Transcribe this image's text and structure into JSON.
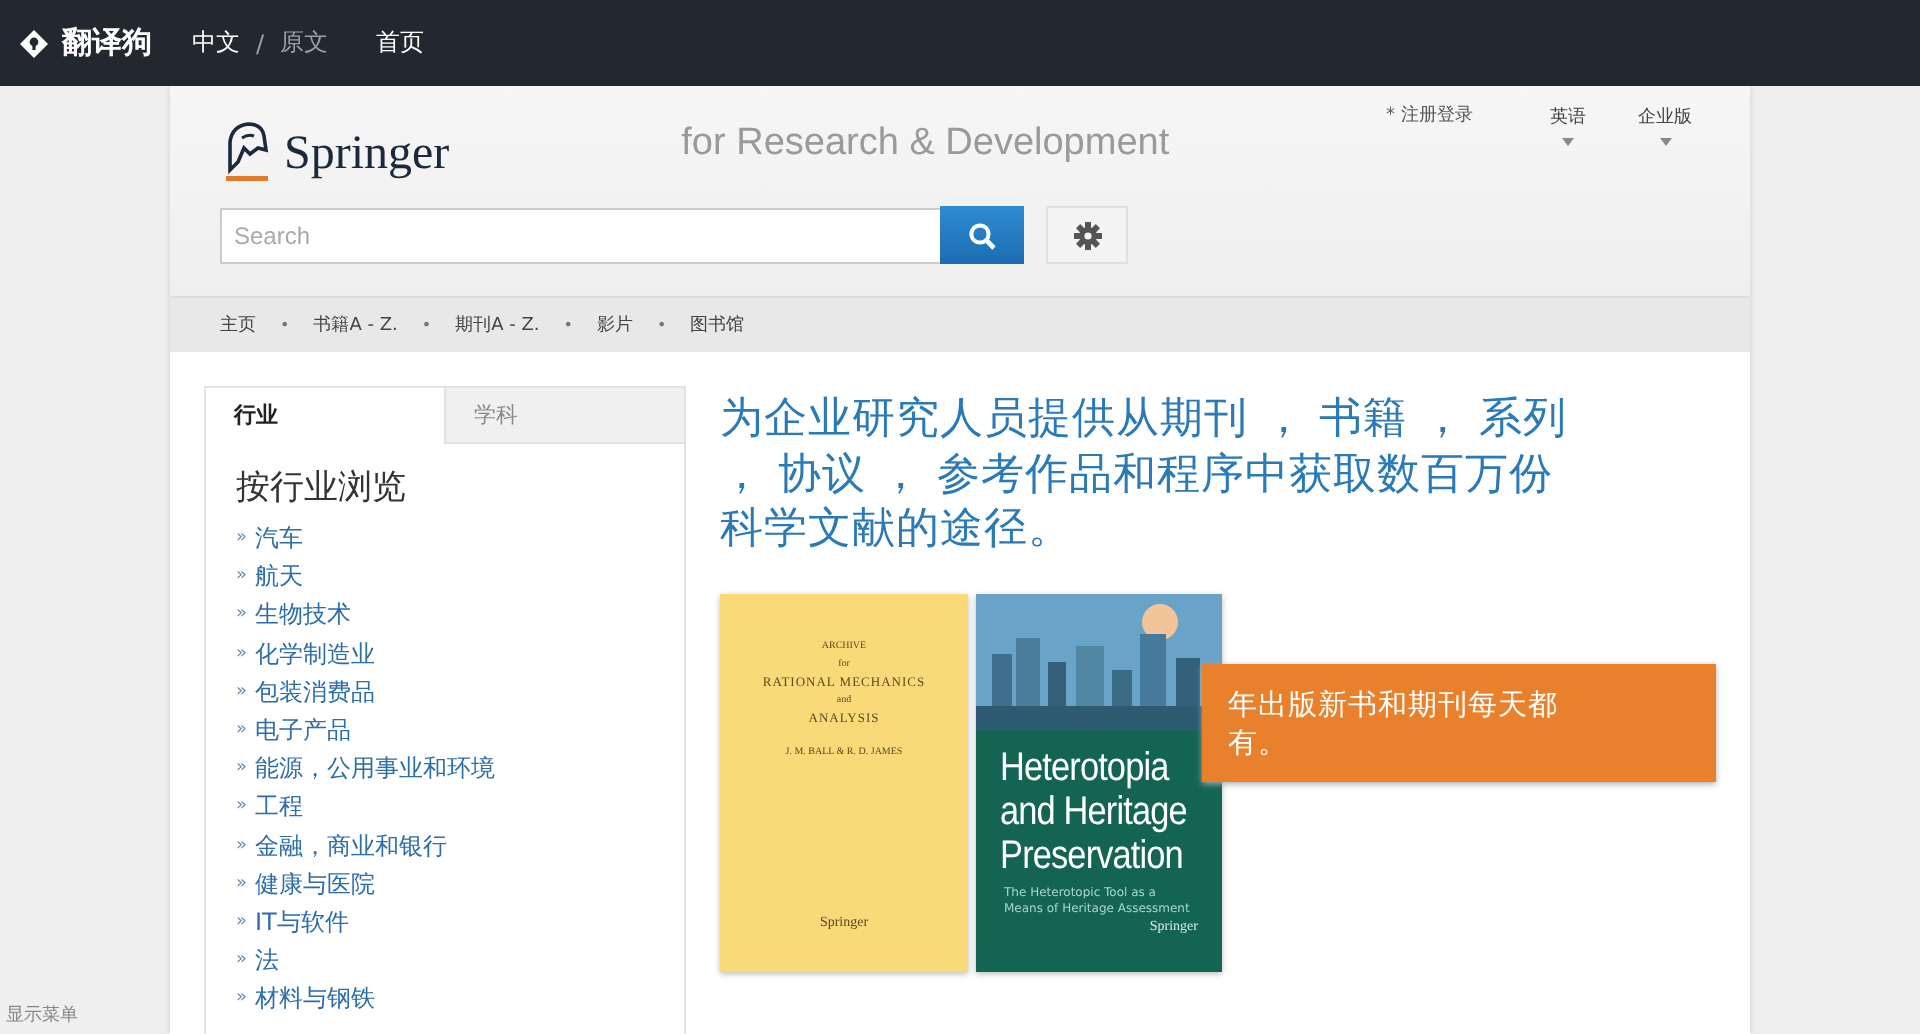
{
  "topbar": {
    "brand": "翻译狗",
    "lang_current": "中文",
    "separator": "/",
    "lang_original": "原文",
    "home": "首页"
  },
  "header": {
    "logo_text": "Springer",
    "tagline": "for Research & Development",
    "register": "* 注册登录",
    "menus": [
      {
        "label": "英语"
      },
      {
        "label": "企业版"
      }
    ],
    "search": {
      "placeholder": "Search"
    }
  },
  "nav": {
    "items": [
      {
        "kind": "link",
        "label": "主页"
      },
      {
        "kind": "separator",
        "label": "•"
      },
      {
        "kind": "link",
        "label": "书籍A - Z."
      },
      {
        "kind": "separator",
        "label": "•"
      },
      {
        "kind": "link",
        "label": "期刊A - Z."
      },
      {
        "kind": "separator",
        "label": "•"
      },
      {
        "kind": "link",
        "label": "影片"
      },
      {
        "kind": "separator",
        "label": "•"
      },
      {
        "kind": "link",
        "label": "图书馆"
      }
    ]
  },
  "sidebar": {
    "tabs": [
      {
        "label": "行业",
        "selected": true
      },
      {
        "label": "学科",
        "selected": false
      }
    ],
    "heading": "按行业浏览",
    "items": [
      {
        "marker": "»",
        "label": "汽车"
      },
      {
        "marker": "»",
        "label": "航天"
      },
      {
        "marker": "»",
        "label": "生物技术"
      },
      {
        "marker": "»",
        "label": "化学制造业"
      },
      {
        "marker": "»",
        "label": "包装消费品"
      },
      {
        "marker": "»",
        "label": "电子产品"
      },
      {
        "marker": "»",
        "label": "能源，公用事业和环境"
      },
      {
        "marker": "»",
        "label": "工程"
      },
      {
        "marker": "»",
        "label": "金融，商业和银行"
      },
      {
        "marker": "»",
        "label": "健康与医院"
      },
      {
        "marker": "»",
        "label": "IT与软件"
      },
      {
        "marker": "»",
        "label": "法"
      },
      {
        "marker": "»",
        "label": "材料与钢铁"
      }
    ]
  },
  "hero": {
    "headline_lines": [
      "为企业研究人员提供从期刊 ， 书籍 ， 系列",
      "， 协议 ， 参考作品和程序中获取数百万份",
      "科学文献的途径。"
    ],
    "covers": [
      {
        "kind": "journal",
        "lines": [
          "ARCHIVE",
          "for",
          "RATIONAL MECHANICS",
          "and",
          "ANALYSIS",
          "J. M. BALL & R. D. JAMES"
        ],
        "publisher": "Springer"
      },
      {
        "kind": "book",
        "title_lines": [
          "Heterotopia",
          "and Heritage",
          "Preservation"
        ],
        "subtitle": "The Heterotopic Tool as a Means of Heritage Assessment",
        "publisher": "Springer"
      }
    ],
    "callout_lines": [
      "年出版新书和期刊每天都",
      "有。"
    ]
  },
  "footer_hint": "显示菜单"
}
